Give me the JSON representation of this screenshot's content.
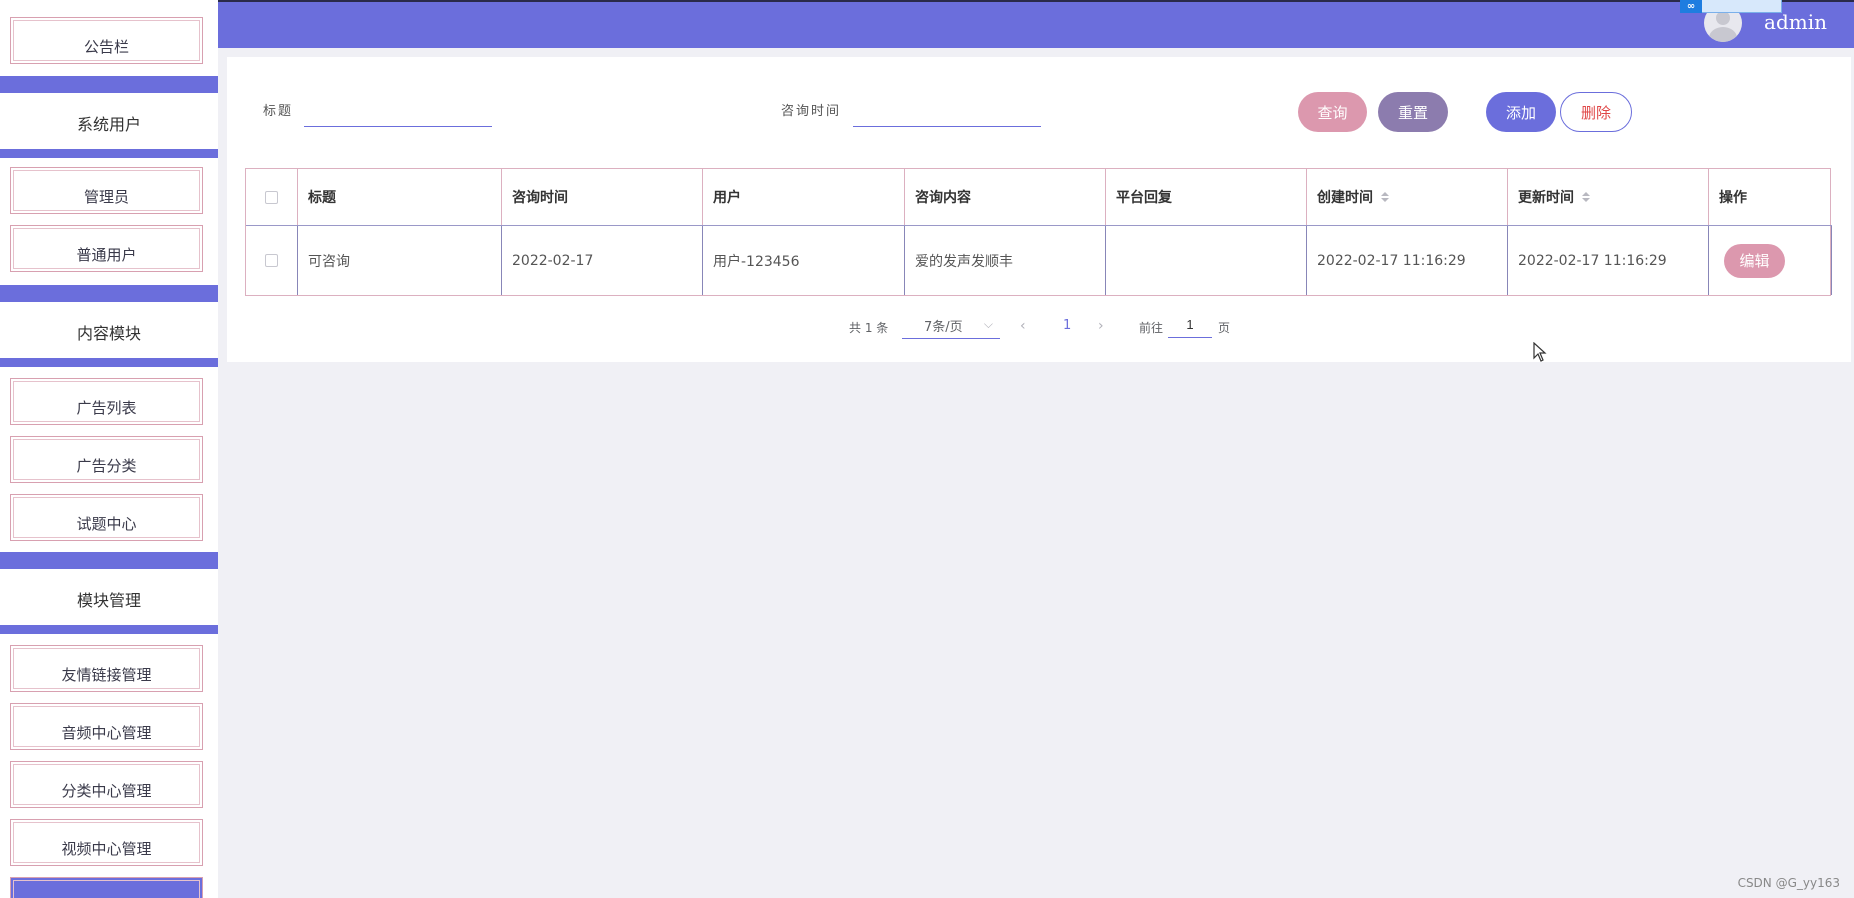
{
  "sidebar": {
    "groups": {
      "system_users": "系统用户",
      "content_module": "内容模块",
      "module_management": "模块管理"
    },
    "items": {
      "bulletin": "公告栏",
      "admin": "管理员",
      "normal_user": "普通用户",
      "ad_list": "广告列表",
      "ad_category": "广告分类",
      "exam_center": "试题中心",
      "friend_links": "友情链接管理",
      "audio_center": "音频中心管理",
      "category_center": "分类中心管理",
      "video_center": "视频中心管理"
    }
  },
  "header": {
    "username": "admin"
  },
  "search": {
    "title_label": "标题",
    "time_label": "咨询时间",
    "title_value": "",
    "time_value": ""
  },
  "buttons": {
    "search": "查询",
    "reset": "重置",
    "add": "添加",
    "delete": "删除",
    "edit": "编辑"
  },
  "table": {
    "columns": {
      "title": "标题",
      "consult_time": "咨询时间",
      "user": "用户",
      "content": "咨询内容",
      "reply": "平台回复",
      "created": "创建时间",
      "updated": "更新时间",
      "actions": "操作"
    },
    "rows": [
      {
        "title": "可咨询",
        "consult_time": "2022-02-17",
        "user": "用户-123456",
        "content": "爱的发声发顺丰",
        "reply": "",
        "created": "2022-02-17 11:16:29",
        "updated": "2022-02-17 11:16:29"
      }
    ]
  },
  "pagination": {
    "total": "共 1 条",
    "page_size": "7条/页",
    "current_page": "1",
    "goto_prefix": "前往",
    "goto_value": "1",
    "goto_suffix": "页"
  },
  "watermark": "CSDN @G_yy163",
  "colors": {
    "primary": "#6b6edc",
    "pink": "#dc98ae",
    "purple_gray": "#8c7cae",
    "danger": "#e04848"
  },
  "icons": {
    "sort": "sort-icon",
    "chevron_down": "chevron-down-icon",
    "prev": "chevron-left-icon",
    "next": "chevron-right-icon",
    "avatar": "user-avatar-icon"
  }
}
